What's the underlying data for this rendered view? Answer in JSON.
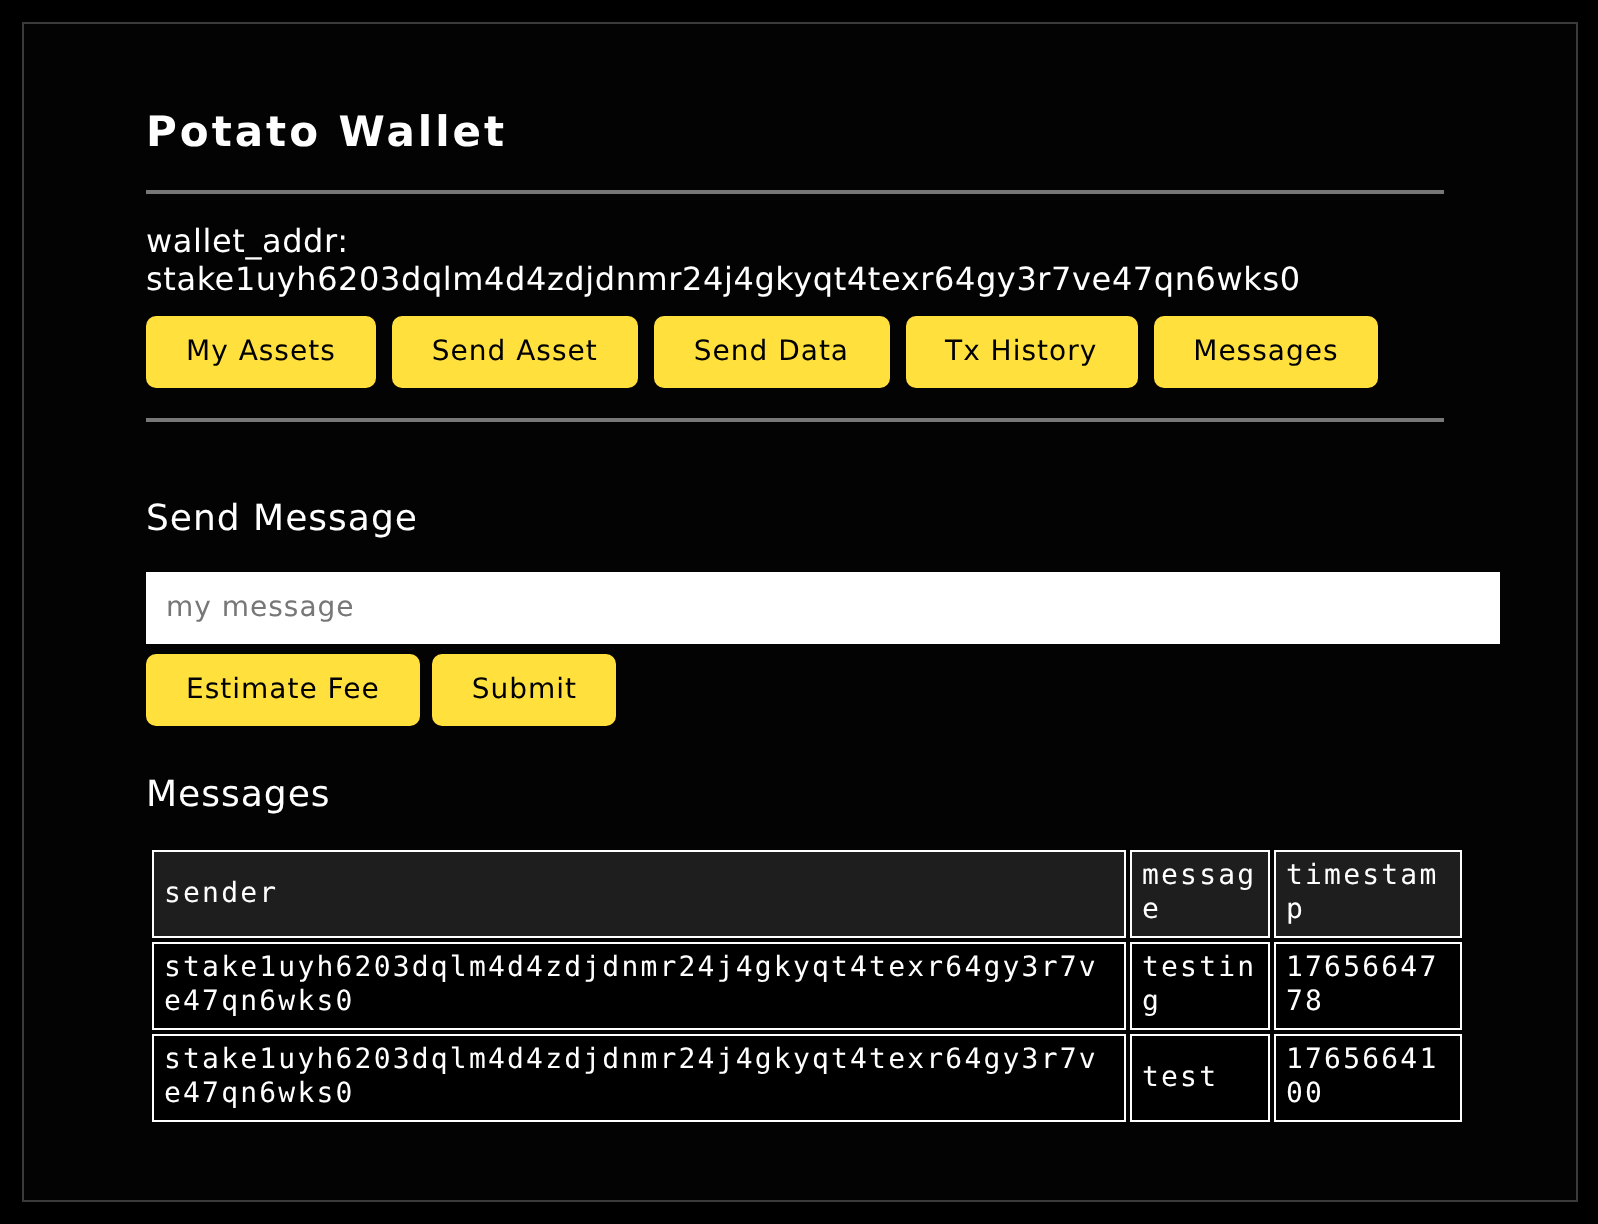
{
  "app_title": "Potato Wallet",
  "wallet": {
    "label": "wallet_addr:",
    "address": "stake1uyh6203dqlm4d4zdjdnmr24j4gkyqt4texr64gy3r7ve47qn6wks0"
  },
  "nav_buttons": [
    "My Assets",
    "Send Asset",
    "Send Data",
    "Tx History",
    "Messages"
  ],
  "send_message": {
    "heading": "Send Message",
    "placeholder": "my message",
    "buttons": [
      "Estimate Fee",
      "Submit"
    ]
  },
  "messages": {
    "heading": "Messages",
    "columns": [
      "sender",
      "message",
      "timestamp"
    ],
    "rows": [
      {
        "sender": "stake1uyh6203dqlm4d4zdjdnmr24j4gkyqt4texr64gy3r7ve47qn6wks0",
        "message": "testing",
        "timestamp": "1765664778"
      },
      {
        "sender": "stake1uyh6203dqlm4d4zdjdnmr24j4gkyqt4texr64gy3r7ve47qn6wks0",
        "message": "test",
        "timestamp": "1765664100"
      }
    ]
  }
}
